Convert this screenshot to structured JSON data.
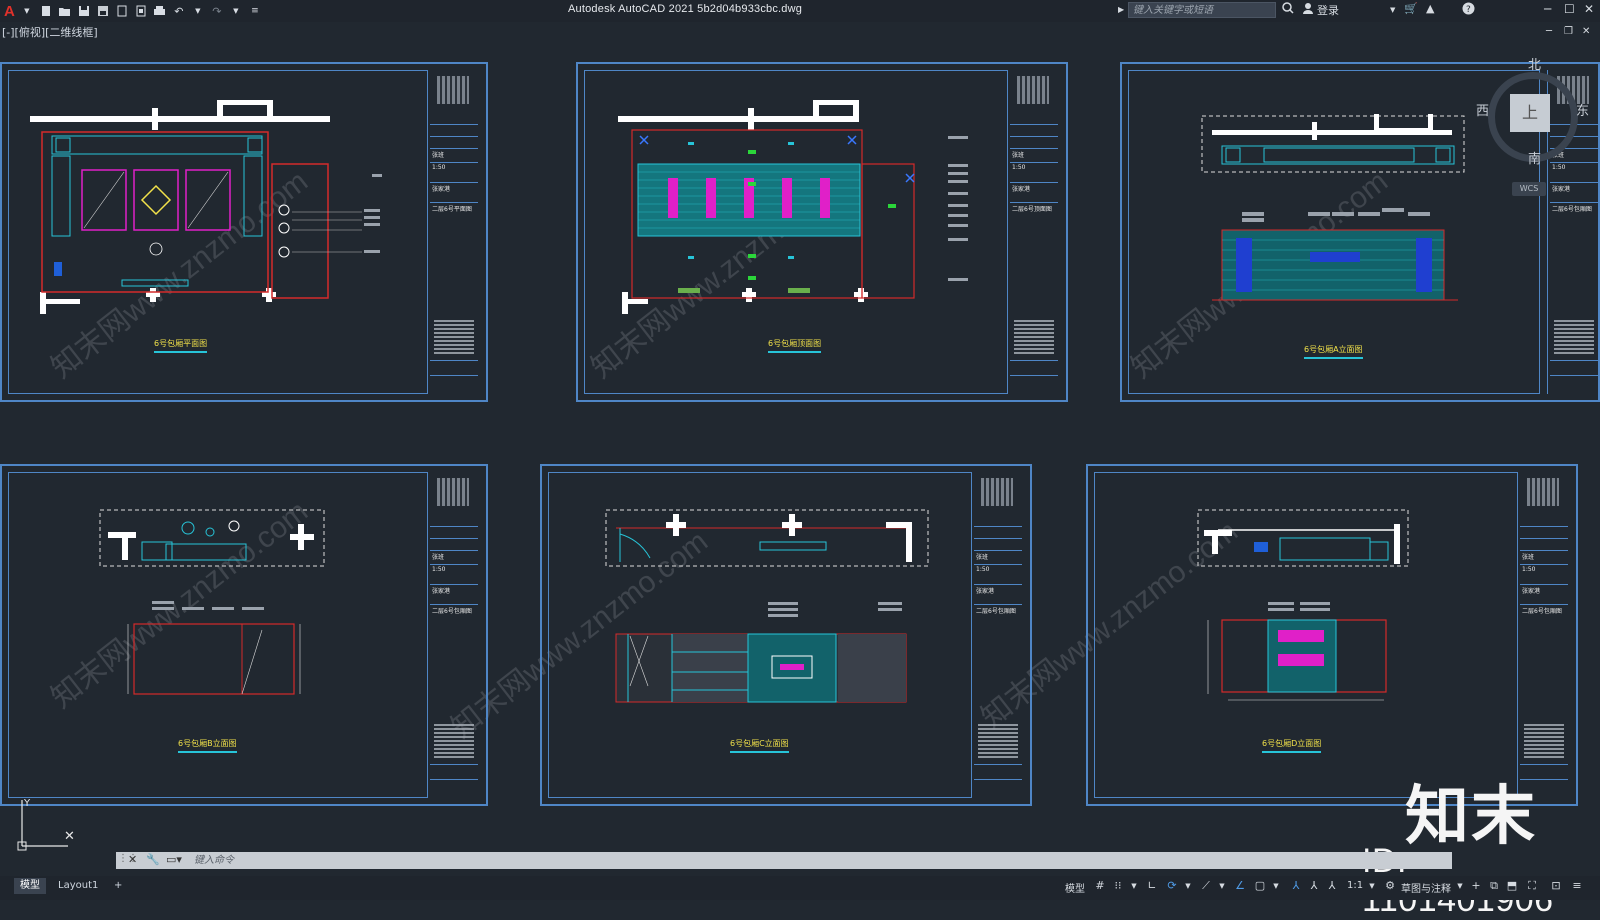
{
  "app": {
    "logo_letter": "A",
    "title": "Autodesk AutoCAD 2021    5b2d04b933cbc.dwg",
    "search_placeholder": "键入关键字或短语",
    "login": "登录",
    "viewport_label": "[-][俯视][二维线框]"
  },
  "viewcube": {
    "north": "北",
    "south": "南",
    "west": "西",
    "east": "东",
    "face": "上",
    "wcs": "WCS"
  },
  "sheets": [
    {
      "label": "6号包厢平面图",
      "tb_scale": "1:50",
      "tb_name": "张家港",
      "tb_title": "二层6号平面图",
      "tb_row": "张班"
    },
    {
      "label": "6号包厢顶面图",
      "tb_scale": "1:50",
      "tb_name": "张家港",
      "tb_title": "二层6号顶面图",
      "tb_row": "张班"
    },
    {
      "label": "6号包厢A立面图",
      "tb_scale": "1:50",
      "tb_name": "张家港",
      "tb_title": "二层6号包厢图",
      "tb_row": "张班"
    },
    {
      "label": "6号包厢B立面图",
      "tb_scale": "1:50",
      "tb_name": "张家港",
      "tb_title": "二层6号包厢图",
      "tb_row": "张班"
    },
    {
      "label": "6号包厢C立面图",
      "tb_scale": "1:50",
      "tb_name": "张家港",
      "tb_title": "二层6号包厢图",
      "tb_row": "张班"
    },
    {
      "label": "6号包厢D立面图",
      "tb_scale": "1:50",
      "tb_name": "张家港",
      "tb_title": "二层6号包厢图",
      "tb_row": "张班"
    }
  ],
  "command": {
    "placeholder": "键入命令"
  },
  "tabs": {
    "model": "模型",
    "layout1": "Layout1",
    "add": "+"
  },
  "status": {
    "model": "模型",
    "scale": "1:1",
    "workspace": "草图与注释"
  },
  "watermark": {
    "brand": "知末",
    "id": "ID: 1101401906",
    "repeat": "知末网www.znzmo.com"
  },
  "colors": {
    "background": "#212830",
    "sheet_border": "#4f86c6",
    "label": "#f2e24a",
    "cyan": "#27c4d8",
    "red": "#d42a2a",
    "magenta": "#e020c8"
  }
}
